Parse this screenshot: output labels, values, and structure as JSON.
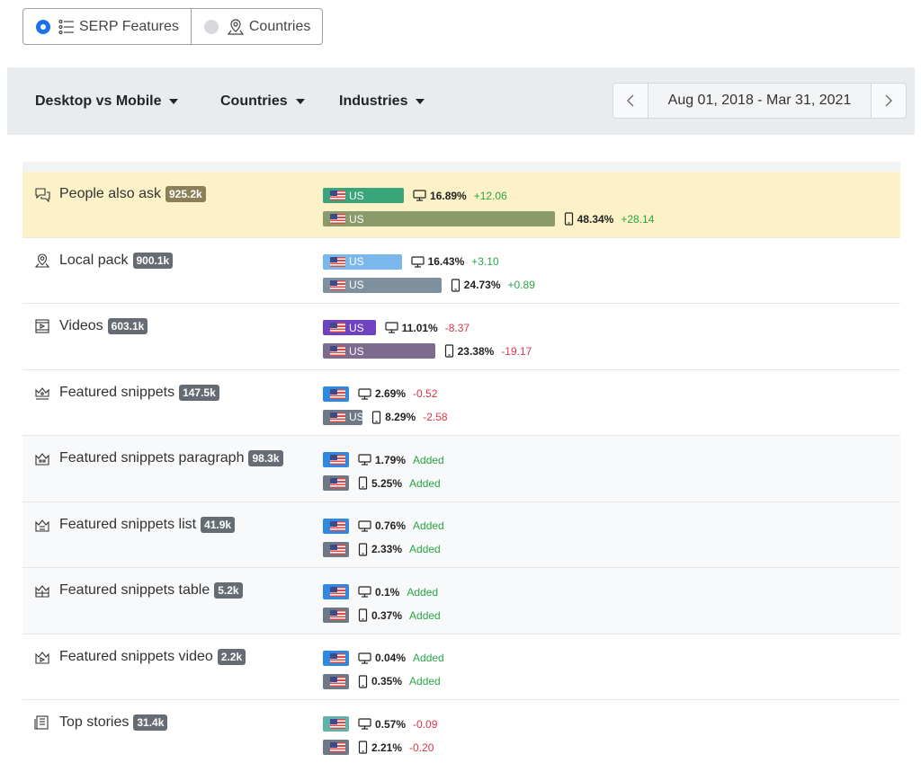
{
  "toggles": [
    {
      "label": "SERP Features",
      "selected": true,
      "icon": "list-icon"
    },
    {
      "label": "Countries",
      "selected": false,
      "icon": "map-pin-icon"
    }
  ],
  "toolbar": {
    "menus": [
      "Desktop vs Mobile",
      "Countries",
      "Industries"
    ],
    "date_range": "Aug 01, 2018 - Mar 31, 2021",
    "prev": "‹",
    "next": "›"
  },
  "colors": {
    "highlight": "#fdf1c8",
    "positive": "#28a745",
    "negative": "#dc3545"
  },
  "features": [
    {
      "name": "People also ask",
      "count": "925.2k",
      "icon": "chat-bubbles-icon",
      "desktop": {
        "country": "US",
        "share": 16.89,
        "pct": "16.89%",
        "change": "+12.06",
        "trend": "pos",
        "color": "#3aa47a"
      },
      "mobile": {
        "country": "US",
        "share": 48.34,
        "pct": "48.34%",
        "change": "+28.14",
        "trend": "pos",
        "color": "#8a9a6a"
      }
    },
    {
      "name": "Local pack",
      "count": "900.1k",
      "icon": "map-pin-icon",
      "desktop": {
        "country": "US",
        "share": 16.43,
        "pct": "16.43%",
        "change": "+3.10",
        "trend": "pos",
        "color": "#7ab8ec"
      },
      "mobile": {
        "country": "US",
        "share": 24.73,
        "pct": "24.73%",
        "change": "+0.89",
        "trend": "pos",
        "color": "#7f909e"
      }
    },
    {
      "name": "Videos",
      "count": "603.1k",
      "icon": "video-icon",
      "desktop": {
        "country": "US",
        "share": 11.01,
        "pct": "11.01%",
        "change": "-8.37",
        "trend": "neg",
        "color": "#6f42c1"
      },
      "mobile": {
        "country": "US",
        "share": 23.38,
        "pct": "23.38%",
        "change": "-19.17",
        "trend": "neg",
        "color": "#7d6b8f"
      }
    },
    {
      "name": "Featured snippets",
      "count": "147.5k",
      "icon": "crown-icon",
      "desktop": {
        "country": "",
        "share": 2.69,
        "pct": "2.69%",
        "change": "-0.52",
        "trend": "neg",
        "color": "#2f89e0"
      },
      "mobile": {
        "country": "US",
        "share": 8.29,
        "pct": "8.29%",
        "change": "-2.58",
        "trend": "neg",
        "color": "#6d7a86"
      }
    },
    {
      "name": "Featured snippets paragraph",
      "count": "98.3k",
      "icon": "quote-crown-icon",
      "desktop": {
        "country": "",
        "share": 1.79,
        "pct": "1.79%",
        "change": "Added",
        "trend": "add",
        "color": "#2f89e0"
      },
      "mobile": {
        "country": "",
        "share": 5.25,
        "pct": "5.25%",
        "change": "Added",
        "trend": "add",
        "color": "#6d7a86"
      }
    },
    {
      "name": "Featured snippets list",
      "count": "41.9k",
      "icon": "list-crown-icon",
      "desktop": {
        "country": "",
        "share": 0.76,
        "pct": "0.76%",
        "change": "Added",
        "trend": "add",
        "color": "#2f89e0"
      },
      "mobile": {
        "country": "",
        "share": 2.33,
        "pct": "2.33%",
        "change": "Added",
        "trend": "add",
        "color": "#6d7a86"
      }
    },
    {
      "name": "Featured snippets table",
      "count": "5.2k",
      "icon": "table-crown-icon",
      "desktop": {
        "country": "",
        "share": 0.1,
        "pct": "0.1%",
        "change": "Added",
        "trend": "add",
        "color": "#2f89e0"
      },
      "mobile": {
        "country": "",
        "share": 0.37,
        "pct": "0.37%",
        "change": "Added",
        "trend": "add",
        "color": "#6d7a86"
      }
    },
    {
      "name": "Featured snippets video",
      "count": "2.2k",
      "icon": "video-crown-icon",
      "desktop": {
        "country": "",
        "share": 0.04,
        "pct": "0.04%",
        "change": "Added",
        "trend": "add",
        "color": "#2f89e0"
      },
      "mobile": {
        "country": "",
        "share": 0.35,
        "pct": "0.35%",
        "change": "Added",
        "trend": "add",
        "color": "#6d7a86"
      }
    },
    {
      "name": "Top stories",
      "count": "31.4k",
      "icon": "newspaper-icon",
      "desktop": {
        "country": "",
        "share": 0.57,
        "pct": "0.57%",
        "change": "-0.09",
        "trend": "neg",
        "color": "#5fb3a8"
      },
      "mobile": {
        "country": "",
        "share": 2.21,
        "pct": "2.21%",
        "change": "-0.20",
        "trend": "neg",
        "color": "#6d7a86"
      }
    }
  ]
}
